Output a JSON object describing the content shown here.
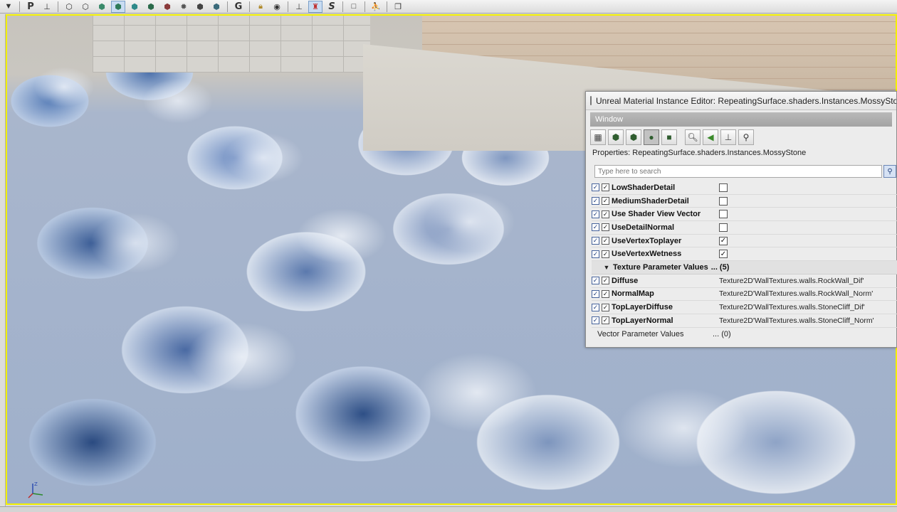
{
  "toolbar": {
    "items": [
      {
        "icon": "dropdown-arrow-icon"
      },
      {
        "letter": "P"
      },
      {
        "icon": "pivot-icon"
      },
      {
        "icon": "cube-wire-icon"
      },
      {
        "icon": "cube-icon"
      },
      {
        "icon": "cube-solid-icon"
      },
      {
        "icon": "cube-lit-icon",
        "active": true
      },
      {
        "icon": "cube-shaded-icon"
      },
      {
        "icon": "cube-textured-icon"
      },
      {
        "icon": "cube-red-icon"
      },
      {
        "icon": "gear-icon"
      },
      {
        "icon": "cube-dark-icon"
      },
      {
        "icon": "cube-detail-icon"
      },
      {
        "letter": "G"
      },
      {
        "icon": "lock-icon"
      },
      {
        "icon": "eye-icon"
      },
      {
        "icon": "camera-icon"
      },
      {
        "icon": "actor-red-icon",
        "active": true
      },
      {
        "letter": "S"
      },
      {
        "icon": "maximize-icon"
      },
      {
        "icon": "user-icon"
      },
      {
        "icon": "restore-icon"
      }
    ]
  },
  "editor": {
    "title": "Unreal Material Instance Editor: RepeatingSurface.shaders.Instances.MossyStone",
    "menu_label": "Window",
    "properties_title": "Properties: RepeatingSurface.shaders.Instances.MossyStone",
    "search_placeholder": "Type here to search",
    "bool_params": [
      {
        "name": "LowShaderDetail",
        "checked": false
      },
      {
        "name": "MediumShaderDetail",
        "checked": false
      },
      {
        "name": "Use Shader View Vector",
        "checked": false
      },
      {
        "name": "UseDetailNormal",
        "checked": false
      },
      {
        "name": "UseVertexToplayer",
        "checked": true
      },
      {
        "name": "UseVertexWetness",
        "checked": true
      }
    ],
    "texture_category": "Texture Parameter Values",
    "texture_count": "... (5)",
    "texture_params": [
      {
        "name": "Diffuse",
        "value": "Texture2D'WallTextures.walls.RockWall_Dif'"
      },
      {
        "name": "NormalMap",
        "value": "Texture2D'WallTextures.walls.RockWall_Norm'"
      },
      {
        "name": "TopLayerDiffuse",
        "value": "Texture2D'WallTextures.walls.StoneCliff_Dif'"
      },
      {
        "name": "TopLayerNormal",
        "value": "Texture2D'WallTextures.walls.StoneCliff_Norm'"
      }
    ],
    "vector_category": "Vector Parameter Values",
    "vector_count": "... (0)"
  }
}
